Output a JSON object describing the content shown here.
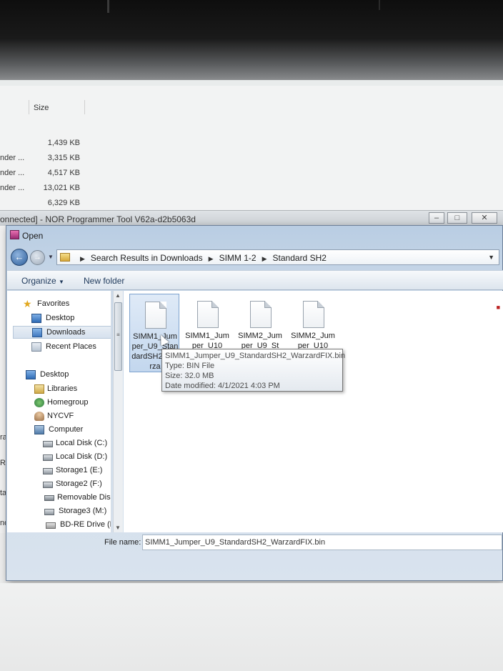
{
  "background_explorer": {
    "column_header": "Size",
    "rows": [
      {
        "type": "",
        "size": "1,439 KB"
      },
      {
        "type": "nder ...",
        "size": "3,315 KB"
      },
      {
        "type": "nder ...",
        "size": "4,517 KB"
      },
      {
        "type": "nder ...",
        "size": "13,021 KB"
      },
      {
        "type": "",
        "size": "6,329 KB"
      }
    ]
  },
  "nor_window": {
    "title": "onnected] - NOR Programmer Tool V62a-d2b5063d"
  },
  "left_fragments": [
    "ra",
    "Rea",
    "ta",
    "nd"
  ],
  "dialog": {
    "title": "Open",
    "breadcrumb": [
      "Search Results in Downloads",
      "SIMM 1-2",
      "Standard SH2"
    ],
    "toolbar": {
      "organize": "Organize",
      "new_folder": "New folder"
    },
    "nav": {
      "favorites": "Favorites",
      "desktop_fav": "Desktop",
      "downloads": "Downloads",
      "recent_places": "Recent Places",
      "desktop": "Desktop",
      "libraries": "Libraries",
      "homegroup": "Homegroup",
      "user": "NYCVF",
      "computer": "Computer",
      "disk_c": "Local Disk (C:)",
      "disk_d": "Local Disk (D:)",
      "storage1": "Storage1 (E:)",
      "storage2": "Storage2 (F:)",
      "removable": "Removable Dis",
      "storage3": "Storage3 (M:)",
      "bdre": "BD-RE Drive (N"
    },
    "files": [
      {
        "name": "SIMM1_Jumper_U9_StandardSH2_Warza",
        "selected": true
      },
      {
        "name": "SIMM1_Jumper_U10",
        "selected": false
      },
      {
        "name": "SIMM2_Jumper_U9_St",
        "selected": false
      },
      {
        "name": "SIMM2_Jumper_U10",
        "selected": false
      }
    ],
    "tooltip": {
      "filename": "SIMM1_Jumper_U9_StandardSH2_WarzardFIX.bin",
      "type": "Type: BIN File",
      "size": "Size: 32.0 MB",
      "modified": "Date modified: 4/1/2021 4:03 PM"
    },
    "file_name_label": "File name:",
    "file_name_value": "SIMM1_Jumper_U9_StandardSH2_WarzardFIX.bin"
  }
}
